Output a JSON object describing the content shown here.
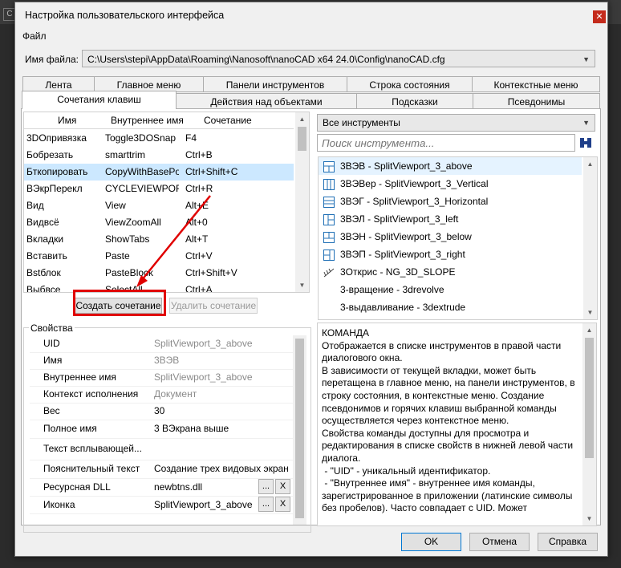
{
  "window": {
    "title": "Настройка пользовательского интерфейса",
    "close_glyph": "✕"
  },
  "menu": {
    "file": "Файл"
  },
  "file": {
    "label": "Имя файла:",
    "value": "C:\\Users\\stepi\\AppData\\Roaming\\Nanosoft\\nanoCAD x64 24.0\\Config\\nanoCAD.cfg"
  },
  "tabs_row1": [
    "Лента",
    "Главное меню",
    "Панели инструментов",
    "Строка состояния",
    "Контекстные меню"
  ],
  "tabs_row2": [
    "Сочетания клавиш",
    "Действия над объектами",
    "Подсказки",
    "Псевдонимы"
  ],
  "shortcuts": {
    "headers": [
      "Имя",
      "Внутреннее имя",
      "Сочетание"
    ],
    "rows": [
      [
        "3DОпривязка",
        "Toggle3DOSnap",
        "F4"
      ],
      [
        "Бобрезать",
        "smarttrim",
        "Ctrl+B"
      ],
      [
        "Бткопировать",
        "CopyWithBasePoint",
        "Ctrl+Shift+C"
      ],
      [
        "ВЭкрПерекл",
        "CYCLEVIEWPORT",
        "Ctrl+R"
      ],
      [
        "Вид",
        "View",
        "Alt+E"
      ],
      [
        "Видвсё",
        "ViewZoomAll",
        "Alt+0"
      ],
      [
        "Вкладки",
        "ShowTabs",
        "Alt+T"
      ],
      [
        "Вставить",
        "Paste",
        "Ctrl+V"
      ],
      [
        "Вstблок",
        "PasteBlock",
        "Ctrl+Shift+V"
      ],
      [
        "Выбвсе",
        "SelectAll",
        "Ctrl+A"
      ]
    ],
    "selected_index": 2,
    "create_button": "Создать сочетание",
    "delete_button": "Удалить сочетание"
  },
  "tools": {
    "filter": "Все инструменты",
    "search_placeholder": "Поиск инструмента...",
    "items": [
      {
        "label": "3ВЭВ - SplitViewport_3_above",
        "icon": "viewport-above-icon"
      },
      {
        "label": "3ВЭВер - SplitViewport_3_Vertical",
        "icon": "viewport-vertical-icon"
      },
      {
        "label": "3ВЭГ - SplitViewport_3_Horizontal",
        "icon": "viewport-horizontal-icon"
      },
      {
        "label": "3ВЭЛ - SplitViewport_3_left",
        "icon": "viewport-left-icon"
      },
      {
        "label": "3ВЭН - SplitViewport_3_below",
        "icon": "viewport-below-icon"
      },
      {
        "label": "3ВЭП - SplitViewport_3_right",
        "icon": "viewport-right-icon"
      },
      {
        "label": "3Открис - NG_3D_SLOPE",
        "icon": "slope-icon"
      },
      {
        "label": "3-вращение - 3drevolve",
        "icon": ""
      },
      {
        "label": "3-выдавливание - 3dextrude",
        "icon": ""
      }
    ],
    "selected_index": 0
  },
  "properties": {
    "title": "Свойства",
    "rows": [
      {
        "key": "UID",
        "value": "SplitViewport_3_above",
        "gray": true
      },
      {
        "key": "Имя",
        "value": "3ВЭВ",
        "gray": true
      },
      {
        "key": "Внутреннее имя",
        "value": "SplitViewport_3_above",
        "gray": true
      },
      {
        "key": "Контекст исполнения",
        "value": "Документ",
        "gray": true
      },
      {
        "key": "Вес",
        "value": "30",
        "gray": false
      },
      {
        "key": "Полное имя",
        "value": "3 ВЭкрана выше",
        "gray": false
      },
      {
        "key": "Текст всплывающей...",
        "value": "",
        "gray": false
      },
      {
        "key": "Пояснительный текст",
        "value": "Создание трех видовых экран",
        "gray": false
      },
      {
        "key": "Ресурсная DLL",
        "value": "newbtns.dll",
        "gray": false
      },
      {
        "key": "Иконка",
        "value": "SplitViewport_3_above",
        "gray": false
      }
    ],
    "browse_glyph": "...",
    "clear_glyph": "X"
  },
  "description": {
    "heading": "КОМАНДА",
    "text": "Отображается в списке инструментов в правой части диалогового окна.\nВ зависимости от текущей вкладки, может быть перетащена в главное меню, на панели инструментов, в строку состояния, в контекстные меню. Создание псевдонимов и горячих клавиш выбранной команды осуществляется через контекстное меню.\nСвойства команды доступны для просмотра и редактирования в списке свойств в нижней левой части диалога.\n - \"UID\" - уникальный идентификатор.\n - \"Внутреннее имя\" - внутреннее имя команды, зарегистрированное в приложении (латинские символы без пробелов). Часто совпадает с UID. Может"
  },
  "buttons": {
    "ok": "OK",
    "cancel": "Отмена",
    "help": "Справка"
  },
  "colors": {
    "selection": "#cce8ff",
    "highlight_box": "#e00000",
    "arrow": "#e00000"
  }
}
